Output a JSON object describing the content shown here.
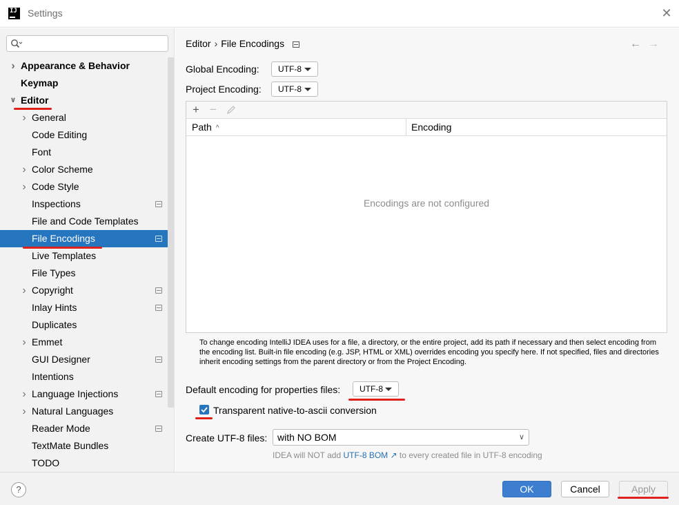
{
  "window": {
    "title": "Settings",
    "app_icon_text": "IJ"
  },
  "sidebar": {
    "search": {
      "value": "",
      "placeholder": ""
    },
    "items": [
      {
        "label": "Appearance & Behavior",
        "level": 0,
        "bold": true,
        "expandable": true
      },
      {
        "label": "Keymap",
        "level": 0,
        "bold": true,
        "expandable": false
      },
      {
        "label": "Editor",
        "level": 0,
        "bold": true,
        "expandable": true,
        "expanded": true
      },
      {
        "label": "General",
        "level": 1,
        "expandable": true
      },
      {
        "label": "Code Editing",
        "level": 1,
        "expandable": false
      },
      {
        "label": "Font",
        "level": 1,
        "expandable": false
      },
      {
        "label": "Color Scheme",
        "level": 1,
        "expandable": true
      },
      {
        "label": "Code Style",
        "level": 1,
        "expandable": true
      },
      {
        "label": "Inspections",
        "level": 1,
        "expandable": false,
        "project_icon": true
      },
      {
        "label": "File and Code Templates",
        "level": 1,
        "expandable": false
      },
      {
        "label": "File Encodings",
        "level": 1,
        "expandable": false,
        "project_icon": true,
        "selected": true
      },
      {
        "label": "Live Templates",
        "level": 1,
        "expandable": false
      },
      {
        "label": "File Types",
        "level": 1,
        "expandable": false
      },
      {
        "label": "Copyright",
        "level": 1,
        "expandable": true,
        "project_icon": true
      },
      {
        "label": "Inlay Hints",
        "level": 1,
        "expandable": false,
        "project_icon": true
      },
      {
        "label": "Duplicates",
        "level": 1,
        "expandable": false
      },
      {
        "label": "Emmet",
        "level": 1,
        "expandable": true
      },
      {
        "label": "GUI Designer",
        "level": 1,
        "expandable": false,
        "project_icon": true
      },
      {
        "label": "Intentions",
        "level": 1,
        "expandable": false
      },
      {
        "label": "Language Injections",
        "level": 1,
        "expandable": true,
        "project_icon": true
      },
      {
        "label": "Natural Languages",
        "level": 1,
        "expandable": true
      },
      {
        "label": "Reader Mode",
        "level": 1,
        "expandable": false,
        "project_icon": true
      },
      {
        "label": "TextMate Bundles",
        "level": 1,
        "expandable": false
      },
      {
        "label": "TODO",
        "level": 1,
        "expandable": false
      }
    ]
  },
  "content": {
    "breadcrumb": {
      "parent": "Editor",
      "separator": "›",
      "current": "File Encodings"
    },
    "global_encoding": {
      "label": "Global Encoding:",
      "value": "UTF-8"
    },
    "project_encoding": {
      "label": "Project Encoding:",
      "value": "UTF-8"
    },
    "table": {
      "columns": [
        "Path",
        "Encoding"
      ],
      "sort_indicator": "^",
      "empty_text": "Encodings are not configured"
    },
    "help_text": "To change encoding IntelliJ IDEA uses for a file, a directory, or the entire project, add its path if necessary and then select encoding from the encoding list. Built-in file encoding (e.g. JSP, HTML or XML) overrides encoding you specify here. If not specified, files and directories inherit encoding settings from the parent directory or from the Project Encoding.",
    "properties_encoding": {
      "label": "Default encoding for properties files:",
      "value": "UTF-8"
    },
    "native_to_ascii": {
      "label": "Transparent native-to-ascii conversion",
      "checked": true
    },
    "create_utf8": {
      "label": "Create UTF-8 files:",
      "value": "with NO BOM"
    },
    "bom_note": {
      "prefix": "IDEA will NOT add",
      "link": "UTF-8 BOM ↗",
      "suffix": "to every created file in UTF-8 encoding"
    }
  },
  "footer": {
    "help": "?",
    "ok": "OK",
    "cancel": "Cancel",
    "apply": "Apply"
  },
  "colors": {
    "accent": "#2675bf",
    "annotation_red": "#e0201b",
    "link": "#2470b3"
  },
  "icons": {
    "search": "search-icon",
    "add": "plus-icon",
    "remove": "minus-icon",
    "edit": "pencil-icon",
    "back": "arrow-left-icon",
    "forward": "arrow-right-icon",
    "close": "close-icon"
  }
}
